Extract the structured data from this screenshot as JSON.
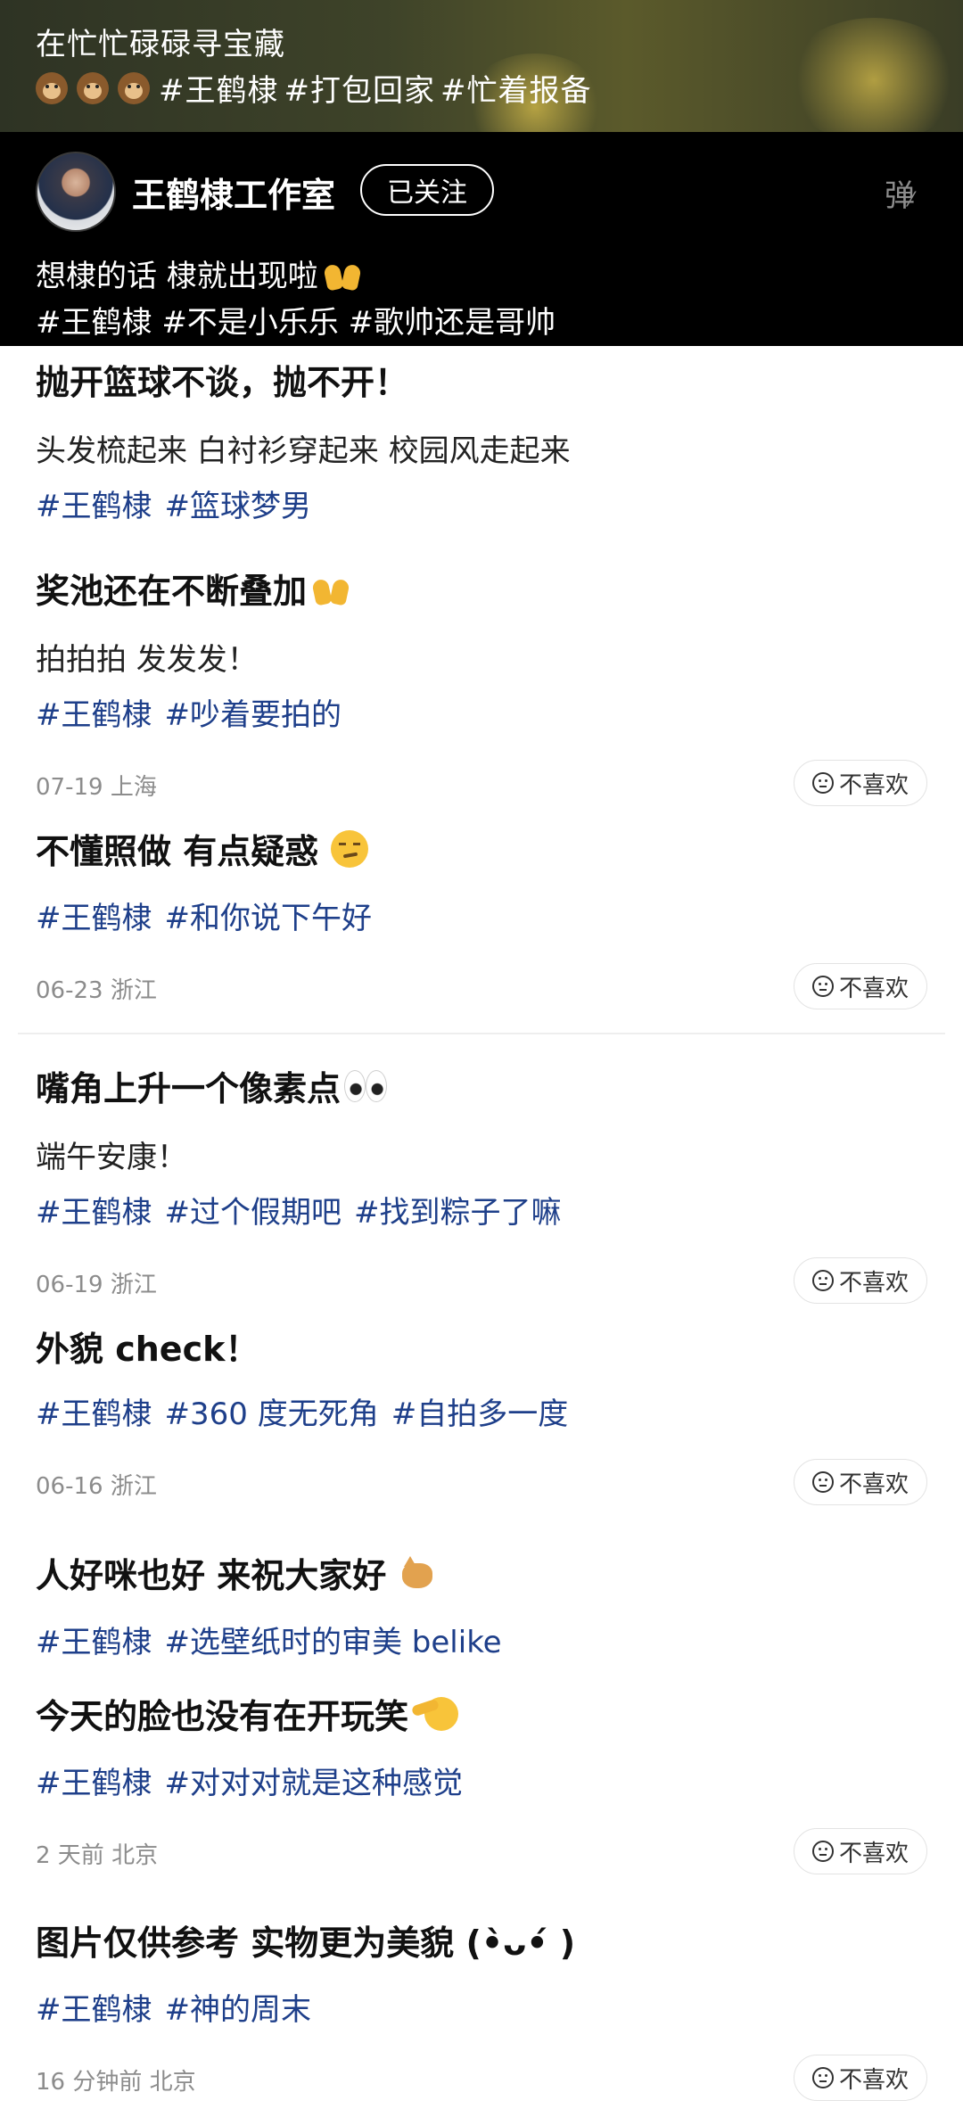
{
  "banner": {
    "line1": "在忙忙碌碌寻宝藏",
    "tags": [
      "#王鹤棣",
      "#打包回家",
      "#忙着报备"
    ]
  },
  "header": {
    "account_name": "王鹤棣工作室",
    "follow_label": "已关注",
    "danmu_label": "弹",
    "caption": "想棣的话 棣就出现啦",
    "tags": [
      "#王鹤棣",
      "#不是小乐乐",
      "#歌帅还是哥帅"
    ]
  },
  "dislike_label": "不喜欢",
  "posts": [
    {
      "title": "抛开篮球不谈，抛不开！",
      "body": "头发梳起来 白衬衫穿起来 校园风走起来",
      "tags": [
        "#王鹤棣",
        "#篮球梦男"
      ]
    },
    {
      "title": "奖池还在不断叠加",
      "body": "拍拍拍 发发发！",
      "tags": [
        "#王鹤棣",
        "#吵着要拍的"
      ],
      "meta": "07-19 上海"
    },
    {
      "title": "不懂照做 有点疑惑",
      "tags": [
        "#王鹤棣",
        "#和你说下午好"
      ],
      "meta": "06-23 浙江"
    },
    {
      "title": "嘴角上升一个像素点",
      "body": "端午安康！",
      "tags": [
        "#王鹤棣",
        "#过个假期吧",
        "#找到粽子了嘛"
      ],
      "meta": "06-19 浙江"
    },
    {
      "title": "外貌 check！",
      "tags": [
        "#王鹤棣",
        "#360 度无死角",
        "#自拍多一度"
      ],
      "meta": "06-16 浙江"
    },
    {
      "title": "人好咪也好 来祝大家好",
      "tags": [
        "#王鹤棣",
        "#选壁纸时的审美 belike"
      ]
    },
    {
      "title": "今天的脸也没有在开玩笑",
      "tags": [
        "#王鹤棣",
        "#对对对就是这种感觉"
      ],
      "meta": "2 天前 北京"
    },
    {
      "title": "图片仅供参考 实物更为美貌 (•̀ᴗ•́ )",
      "tags": [
        "#王鹤棣",
        "#神的周末"
      ],
      "meta": "16 分钟前 北京"
    }
  ]
}
